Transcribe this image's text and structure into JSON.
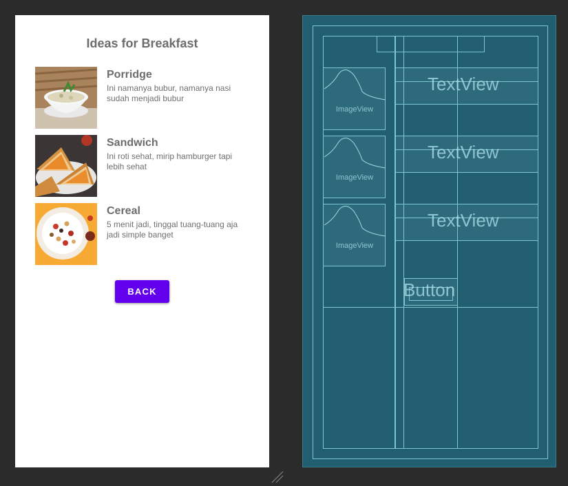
{
  "design": {
    "title": "Ideas for Breakfast",
    "items": [
      {
        "name": "Porridge",
        "description": "Ini namanya bubur, namanya nasi sudah menjadi bubur",
        "image": "porridge-bowl-photo"
      },
      {
        "name": "Sandwich",
        "description": "Ini roti sehat, mirip hamburger tapi lebih sehat",
        "image": "toast-sandwich-photo"
      },
      {
        "name": "Cereal",
        "description": "5 menit jadi, tinggal tuang-tuang aja jadi simple banget",
        "image": "cereal-bowl-photo"
      }
    ],
    "back_button": "BACK",
    "accent_color": "#6200ee"
  },
  "blueprint": {
    "background_color": "#215f70",
    "image_view_label": "ImageView",
    "text_view_label": "TextView",
    "button_label": "Button"
  }
}
